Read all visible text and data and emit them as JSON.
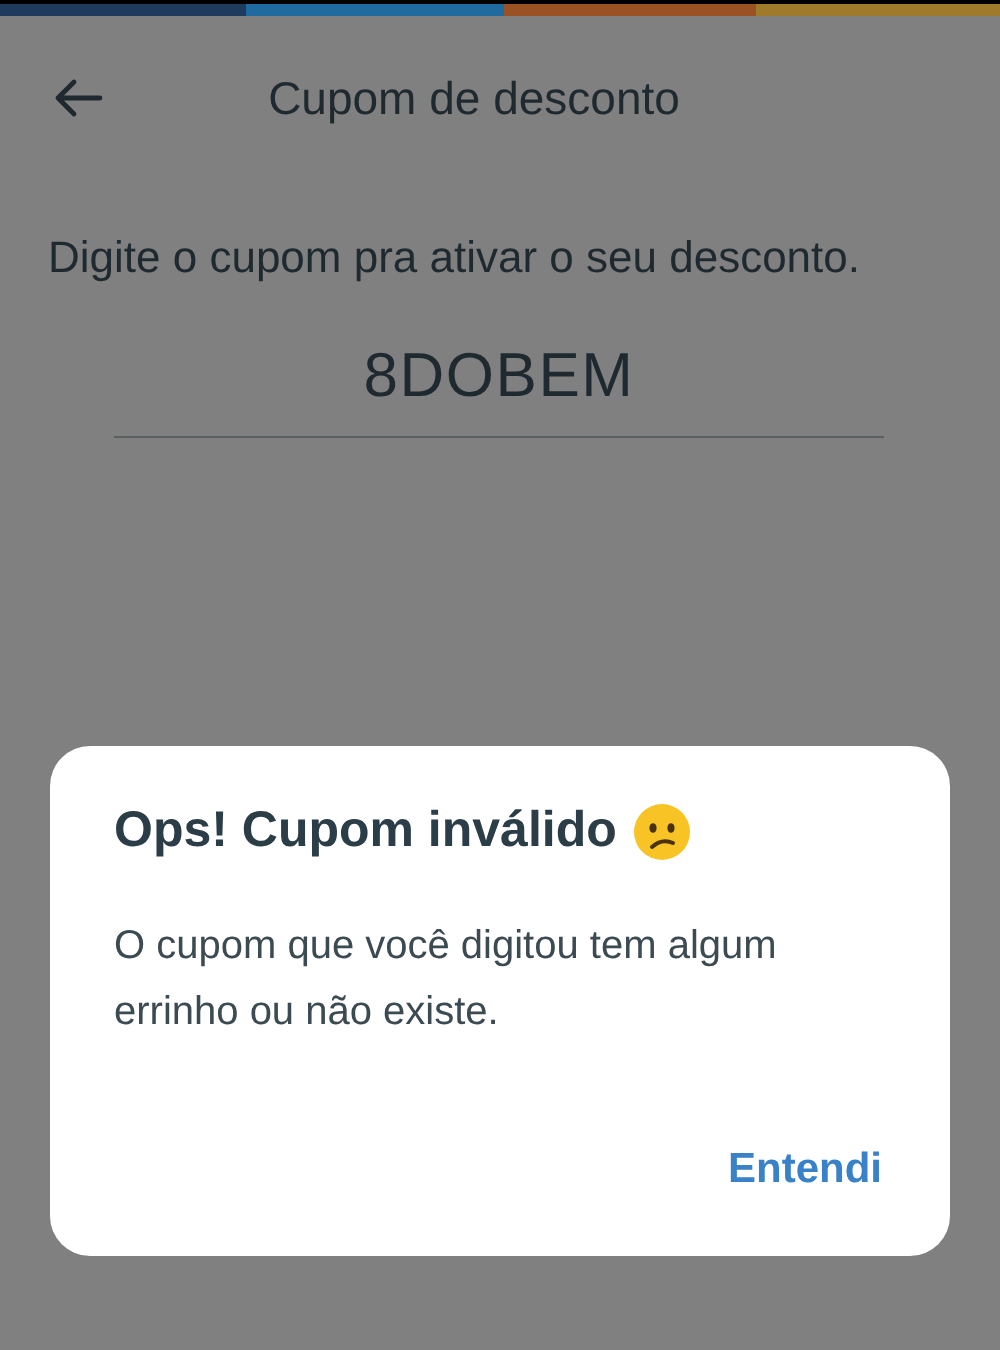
{
  "screen": {
    "title": "Cupom de desconto",
    "instruction": "Digite o cupom pra ativar o seu desconto.",
    "coupon_field": {
      "value": "8DOBEM"
    }
  },
  "dialog": {
    "title": "Ops! Cupom inválido",
    "message": "O cupom que você digitou tem algum errinho ou não existe.",
    "button": "Entendi"
  }
}
